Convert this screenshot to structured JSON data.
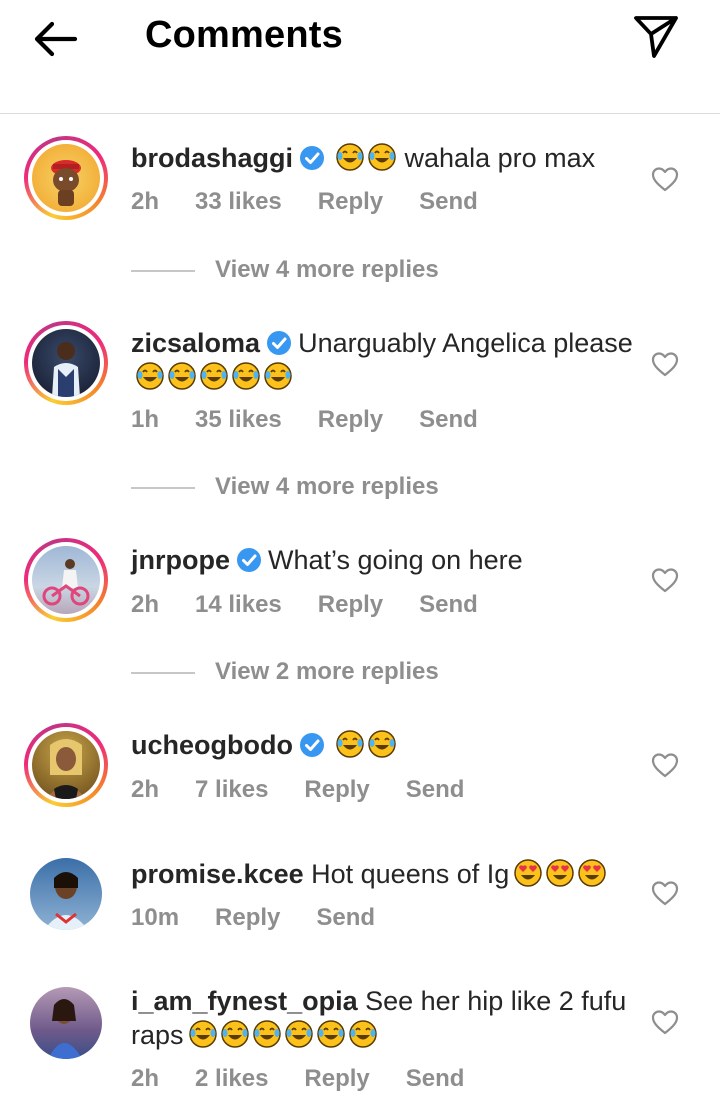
{
  "header": {
    "title": "Comments"
  },
  "comments": [
    {
      "username": "brodashaggi",
      "verified": true,
      "text": "wahala pro max",
      "emoji_before": 2,
      "emoji_after": 0,
      "emoji_type": "laughing",
      "time": "2h",
      "likes": "33 likes",
      "reply": "Reply",
      "send": "Send",
      "view_replies": "View 4 more replies",
      "story_ring": true
    },
    {
      "username": "zicsaloma",
      "verified": true,
      "text": "Unarguably Angelica please",
      "emoji_before": 0,
      "emoji_after": 5,
      "emoji_type": "laughing",
      "time": "1h",
      "likes": "35 likes",
      "reply": "Reply",
      "send": "Send",
      "view_replies": "View 4 more replies",
      "story_ring": true
    },
    {
      "username": "jnrpope",
      "verified": true,
      "text": "What’s going on here",
      "emoji_before": 0,
      "emoji_after": 0,
      "emoji_type": "laughing",
      "time": "2h",
      "likes": "14 likes",
      "reply": "Reply",
      "send": "Send",
      "view_replies": "View 2 more replies",
      "story_ring": true
    },
    {
      "username": "ucheogbodo",
      "verified": true,
      "text": "",
      "emoji_before": 2,
      "emoji_after": 0,
      "emoji_type": "laughing",
      "time": "2h",
      "likes": "7 likes",
      "reply": "Reply",
      "send": "Send",
      "view_replies": "",
      "story_ring": true
    },
    {
      "username": "promise.kcee",
      "verified": false,
      "text": "Hot queens of Ig",
      "emoji_before": 0,
      "emoji_after": 3,
      "emoji_type": "heart-eyes",
      "time": "10m",
      "likes": "",
      "reply": "Reply",
      "send": "Send",
      "view_replies": "",
      "story_ring": false
    },
    {
      "username": "i_am_fynest_opia",
      "verified": false,
      "text": "See her hip like 2 fufu raps",
      "emoji_before": 0,
      "emoji_after": 6,
      "emoji_type": "laughing",
      "time": "2h",
      "likes": "2 likes",
      "reply": "Reply",
      "send": "Send",
      "view_replies": "",
      "story_ring": false
    }
  ],
  "colors": {
    "text": "#262626",
    "muted": "#8e8e8e",
    "verified": "#3897f0",
    "divider": "#dbdbdb"
  },
  "icons": {
    "back": "arrow-left-icon",
    "send": "paper-plane-icon",
    "like": "heart-outline-icon",
    "verified": "verified-badge-icon"
  }
}
